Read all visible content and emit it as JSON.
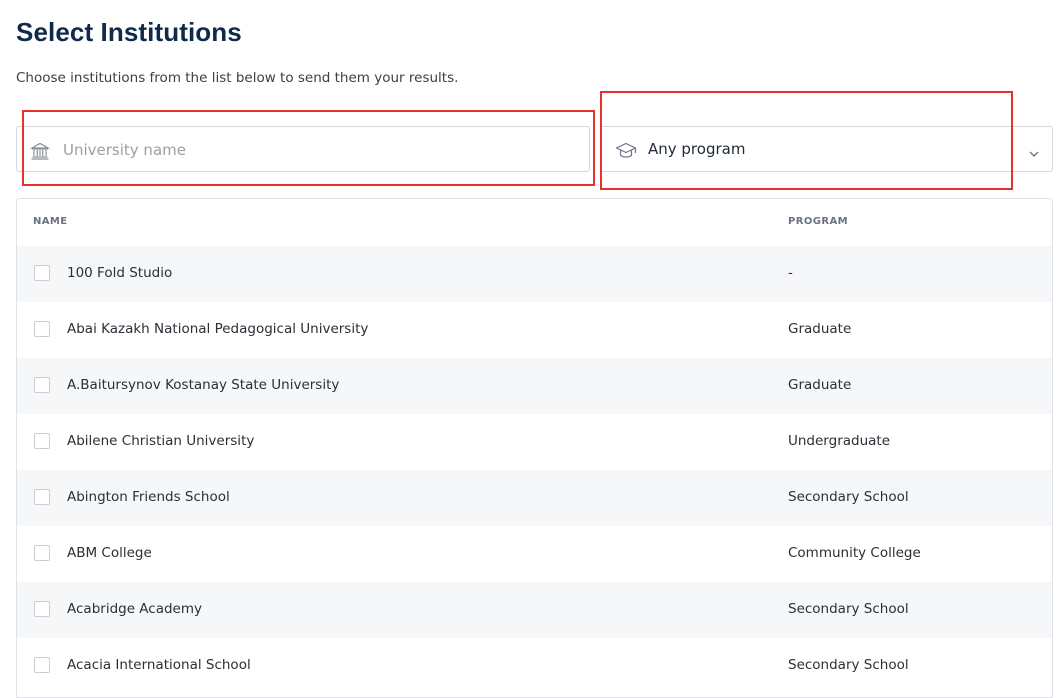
{
  "page": {
    "title": "Select Institutions",
    "subtitle": "Choose institutions from the list below to send them your results."
  },
  "search": {
    "placeholder": "University name",
    "icon": "institution-icon"
  },
  "program_filter": {
    "selected": "Any program",
    "icon": "graduation-cap-icon",
    "chevron": "chevron-down-icon"
  },
  "table": {
    "headers": {
      "name": "NAME",
      "program": "PROGRAM"
    },
    "rows": [
      {
        "name": "100 Fold Studio",
        "program": "-"
      },
      {
        "name": "Abai Kazakh National Pedagogical University",
        "program": "Graduate"
      },
      {
        "name": "A.Baitursynov Kostanay State University",
        "program": "Graduate"
      },
      {
        "name": "Abilene Christian University",
        "program": "Undergraduate"
      },
      {
        "name": "Abington Friends School",
        "program": "Secondary School"
      },
      {
        "name": "ABM College",
        "program": "Community College"
      },
      {
        "name": "Acabridge Academy",
        "program": "Secondary School"
      },
      {
        "name": "Acacia International School",
        "program": "Secondary School"
      }
    ]
  },
  "colors": {
    "title": "#0f2a4a",
    "highlight": "#e5322d",
    "row_alt": "#f6f7f9",
    "border": "#d5d9de"
  }
}
